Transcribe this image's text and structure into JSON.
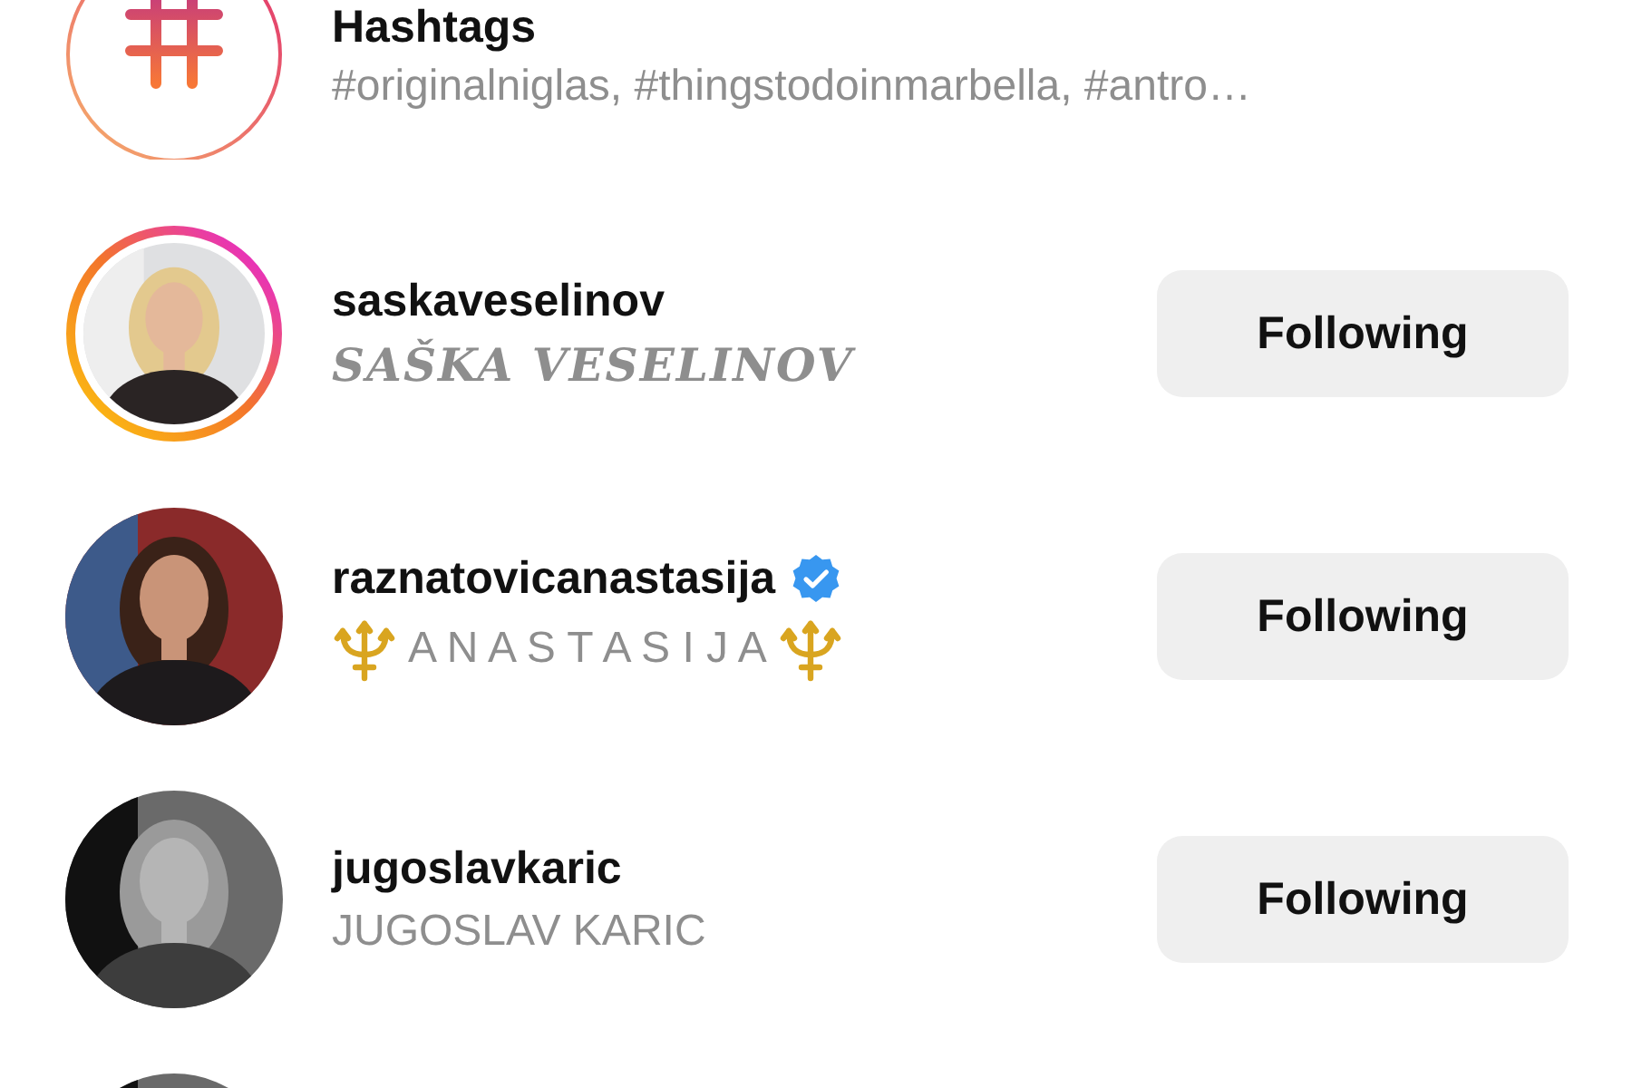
{
  "list": [
    {
      "kind": "hashtag",
      "title": "Hashtags",
      "subtitle": "#originalniglas, #thingstodoinmarbella, #antro…"
    },
    {
      "kind": "account",
      "username": "saskaveselinov",
      "subtitle": {
        "kind": "serif",
        "text": "SAŠKA VESELINOV"
      },
      "story_ring": true,
      "verified": false,
      "button": "Following"
    },
    {
      "kind": "account",
      "username": "raznatovicanastasija",
      "subtitle": {
        "kind": "trident",
        "text": "A N A S T A S I J A"
      },
      "story_ring": false,
      "verified": true,
      "button": "Following"
    },
    {
      "kind": "account",
      "username": "jugoslavkaric",
      "subtitle": {
        "kind": "plain",
        "text": "JUGOSLAV KARIC"
      },
      "story_ring": false,
      "verified": false,
      "button": "Following"
    },
    {
      "kind": "cut"
    }
  ]
}
